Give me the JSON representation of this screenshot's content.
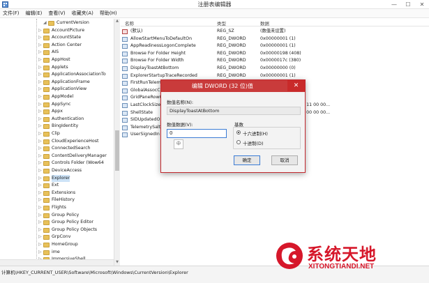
{
  "window": {
    "title": "注册表编辑器",
    "minimize_glyph": "—",
    "maximize_glyph": "☐",
    "close_glyph": "✕"
  },
  "menu": [
    "文件(F)",
    "编辑(E)",
    "查看(V)",
    "收藏夹(A)",
    "帮助(H)"
  ],
  "tree": {
    "root": "CurrentVersion",
    "items": [
      "AccountPicture",
      "AccountState",
      "Action Center",
      "AIS",
      "AppHost",
      "Applets",
      "ApplicationAssociationTo",
      "ApplicationFrame",
      "ApplicationView",
      "AppModel",
      "AppSync",
      "Appx",
      "Authentication",
      "BingIdentity",
      "Clip",
      "CloudExperienceHost",
      "ConnectedSearch",
      "ContentDeliveryManager",
      "Controls Folder (Wow64",
      "DeviceAccess",
      "Explorer",
      "Ext",
      "Extensions",
      "FileHistory",
      "Flights",
      "Group Policy",
      "Group Policy Editor",
      "Group Policy Objects",
      "GrpConv",
      "HomeGroup",
      "ime",
      "ImmersiveShell"
    ],
    "selected": "Explorer"
  },
  "list": {
    "columns": [
      "名称",
      "类型",
      "数据"
    ],
    "rows": [
      {
        "name": "(默认)",
        "type": "REG_SZ",
        "data": "(数值未设置)",
        "icon": "string-value-icon"
      },
      {
        "name": "AllowStartMenuToDefaultOn",
        "type": "REG_DWORD",
        "data": "0x00000001 (1)",
        "icon": "dword-value-icon"
      },
      {
        "name": "AppReadinessLogonComplete",
        "type": "REG_DWORD",
        "data": "0x00000001 (1)",
        "icon": "dword-value-icon"
      },
      {
        "name": "Browse For Folder Height",
        "type": "REG_DWORD",
        "data": "0x00000198 (408)",
        "icon": "dword-value-icon"
      },
      {
        "name": "Browse For Folder Width",
        "type": "REG_DWORD",
        "data": "0x0000017c (380)",
        "icon": "dword-value-icon"
      },
      {
        "name": "DisplayToastAtBottom",
        "type": "REG_DWORD",
        "data": "0x00000000 (0)",
        "icon": "dword-value-icon"
      },
      {
        "name": "ExplorerStartupTraceRecorded",
        "type": "REG_DWORD",
        "data": "0x00000001 (1)",
        "icon": "dword-value-icon"
      },
      {
        "name": "FirstRunTeleme",
        "type": "",
        "data": "",
        "icon": "dword-value-icon"
      },
      {
        "name": "GlobalAssocCh",
        "type": "",
        "data": "",
        "icon": "dword-value-icon"
      },
      {
        "name": "GridPaneRowC",
        "type": "",
        "data": "",
        "icon": "dword-value-icon"
      },
      {
        "name": "LastClockSize",
        "type": "",
        "data": "0 00 00 42 00 00 00 11 00 00...",
        "icon": "dword-value-icon"
      },
      {
        "name": "ShellState",
        "type": "",
        "data": "0 00 00 00 00 00 00 00 00 00...",
        "icon": "dword-value-icon"
      },
      {
        "name": "SIDUpdatedOn",
        "type": "",
        "data": "",
        "icon": "dword-value-icon"
      },
      {
        "name": "TelemetrySalt",
        "type": "",
        "data": "",
        "icon": "dword-value-icon"
      },
      {
        "name": "UserSignedIn",
        "type": "",
        "data": "",
        "icon": "dword-value-icon"
      }
    ]
  },
  "status": {
    "path": "计算机\\HKEY_CURRENT_USER\\Software\\Microsoft\\Windows\\CurrentVersion\\Explorer"
  },
  "dialog": {
    "title": "编辑 DWORD (32 位)值",
    "name_label": "数值名称(N):",
    "name_value": "DisplayToastAtBottom",
    "data_label": "数值数据(V):",
    "data_value": "0",
    "ime_label": "中",
    "base_label": "基数",
    "radio_hex": "十六进制(H)",
    "radio_dec": "十进制(D)",
    "ok": "确定",
    "cancel": "取消"
  },
  "watermark": {
    "brand": "系统天地",
    "site": "XITONGTIANDI.NET"
  },
  "colors": {
    "dialog_title": "#c93b3b",
    "watermark": "#d6172a",
    "folder": "#e8c15a"
  }
}
